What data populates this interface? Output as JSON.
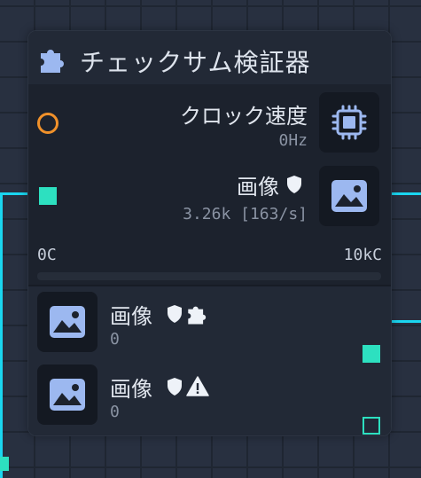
{
  "node": {
    "title": "チェックサム検証器",
    "title_icon": "puzzle-icon",
    "inputs": [
      {
        "label": "クロック速度",
        "value": "0Hz",
        "icon": "cpu-chip-icon",
        "port": "circle-outline"
      },
      {
        "label": "画像",
        "value": "3.26k [163/s]",
        "icon": "image-icon",
        "badges": [
          "shield-icon"
        ],
        "port": "filled-square"
      }
    ],
    "range": {
      "min_label": "0C",
      "max_label": "10kC",
      "fraction": 0
    },
    "outputs": [
      {
        "label": "画像",
        "value": "0",
        "icon": "image-icon",
        "badges": [
          "shield-icon",
          "puzzle-icon"
        ],
        "port": "filled-square"
      },
      {
        "label": "画像",
        "value": "0",
        "icon": "image-icon",
        "badges": [
          "shield-icon",
          "warning-icon"
        ],
        "port": "outline-square"
      }
    ]
  },
  "colors": {
    "background": "#283040",
    "node_bg": "#1c222d",
    "wire": "#1ad6f0",
    "port_filled": "#2de0c0",
    "clock_port": "#f0912a",
    "icon_blue": "#9cb8f0"
  }
}
